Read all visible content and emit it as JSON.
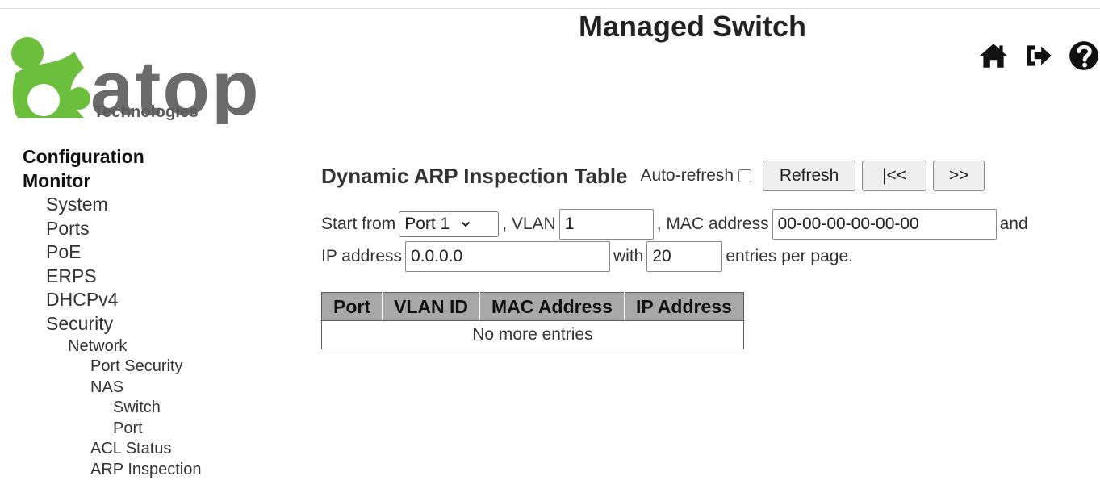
{
  "header": {
    "title": "Managed Switch",
    "icons": [
      "home-icon",
      "logout-icon",
      "help-icon"
    ]
  },
  "logo": {
    "text": "atop",
    "subtext": "Technologies",
    "colors": {
      "green": "#6cbf3c",
      "gray": "#6b6b6b"
    }
  },
  "sidebar": {
    "items": [
      {
        "label": "Configuration",
        "level": 0
      },
      {
        "label": "Monitor",
        "level": 0
      },
      {
        "label": "System",
        "level": 1
      },
      {
        "label": "Ports",
        "level": 1
      },
      {
        "label": "PoE",
        "level": 1
      },
      {
        "label": "ERPS",
        "level": 1
      },
      {
        "label": "DHCPv4",
        "level": 1
      },
      {
        "label": "Security",
        "level": 1
      },
      {
        "label": "Network",
        "level": 2
      },
      {
        "label": "Port Security",
        "level": 3
      },
      {
        "label": "NAS",
        "level": 3
      },
      {
        "label": "Switch",
        "level": 4
      },
      {
        "label": "Port",
        "level": 4
      },
      {
        "label": "ACL Status",
        "level": 3
      },
      {
        "label": "ARP Inspection",
        "level": 3
      }
    ]
  },
  "main": {
    "title": "Dynamic ARP Inspection Table",
    "auto_refresh_label": "Auto-refresh",
    "auto_refresh_checked": false,
    "buttons": {
      "refresh": "Refresh",
      "first": "|<<",
      "next": ">>"
    },
    "form": {
      "start_from_label": "Start from",
      "start_port": "Port 1",
      "vlan_label": ", VLAN",
      "vlan_value": "1",
      "mac_label": ", MAC address",
      "mac_value": "00-00-00-00-00-00",
      "and_label": "and",
      "ip_label": "IP address",
      "ip_value": "0.0.0.0",
      "with_label": "with",
      "entries_value": "20",
      "entries_suffix": "entries per page."
    },
    "table": {
      "columns": [
        "Port",
        "VLAN ID",
        "MAC Address",
        "IP Address"
      ],
      "empty_message": "No more entries"
    }
  }
}
